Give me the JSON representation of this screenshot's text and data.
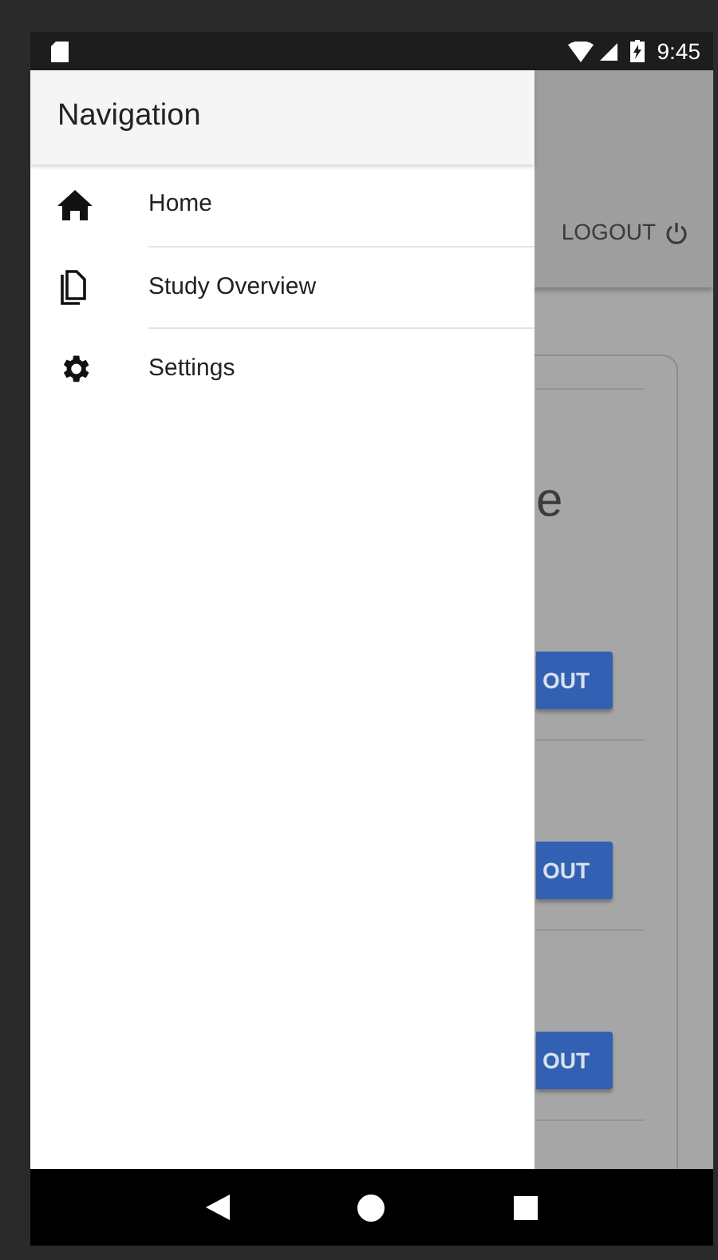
{
  "status_bar": {
    "time": "9:45"
  },
  "drawer": {
    "title": "Navigation",
    "items": [
      {
        "label": "Home",
        "kind": "home"
      },
      {
        "label": "Study Overview",
        "kind": "document"
      },
      {
        "label": "Settings",
        "kind": "gear"
      }
    ]
  },
  "background": {
    "logout": "LOGOUT",
    "heading_fragment": "e",
    "buttons": [
      "OUT",
      "OUT",
      "OUT"
    ]
  }
}
